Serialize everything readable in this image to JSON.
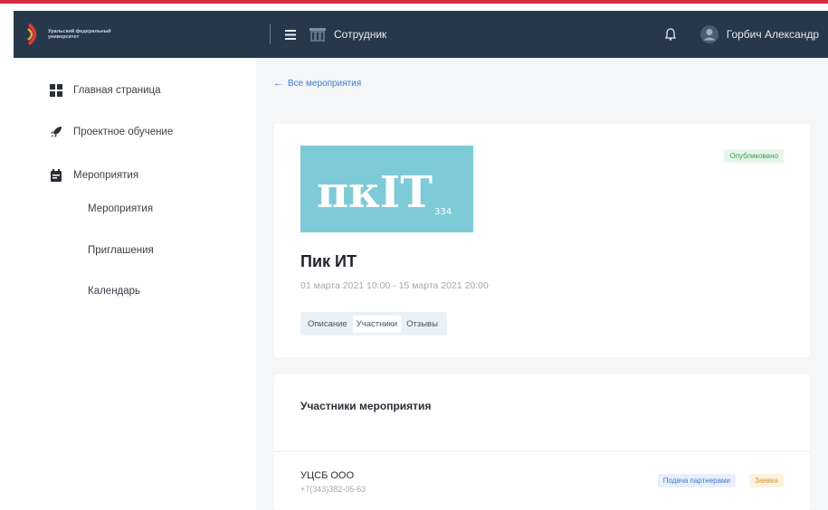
{
  "header": {
    "logo_text": "Уральский федеральный университет",
    "org_label": "Сотрудник",
    "user_name": "Горбич Александр"
  },
  "sidebar": {
    "items": [
      {
        "label": "Главная страница",
        "icon": "dashboard-icon"
      },
      {
        "label": "Проектное обучение",
        "icon": "rocket-icon"
      },
      {
        "label": "Мероприятия",
        "icon": "calendar-icon"
      }
    ],
    "sub_items": [
      {
        "label": "Мероприятия"
      },
      {
        "label": "Приглашения"
      },
      {
        "label": "Календарь"
      }
    ]
  },
  "main": {
    "back_link": "Все мероприятия",
    "event": {
      "logo_text": "πкIT",
      "logo_sub": "334",
      "status": "Опубликовано",
      "title": "Пик ИТ",
      "dates": "01 марта 2021 10:00 - 15 марта 2021 20:00",
      "tabs": [
        {
          "label": "Описание",
          "active": false
        },
        {
          "label": "Участники",
          "active": true
        },
        {
          "label": "Отзывы",
          "active": false
        }
      ]
    },
    "participants": {
      "title": "Участники мероприятия",
      "rows": [
        {
          "name": "УЦСБ ООО",
          "phone": "+7(343)382-05-63",
          "badges": [
            "Подача партнерами",
            "Заявка"
          ]
        }
      ]
    }
  },
  "colors": {
    "topbar": "#26384a",
    "accent_red": "#d6283f",
    "event_logo_bg": "#7ecbd7",
    "link_blue": "#3a7bd5"
  }
}
